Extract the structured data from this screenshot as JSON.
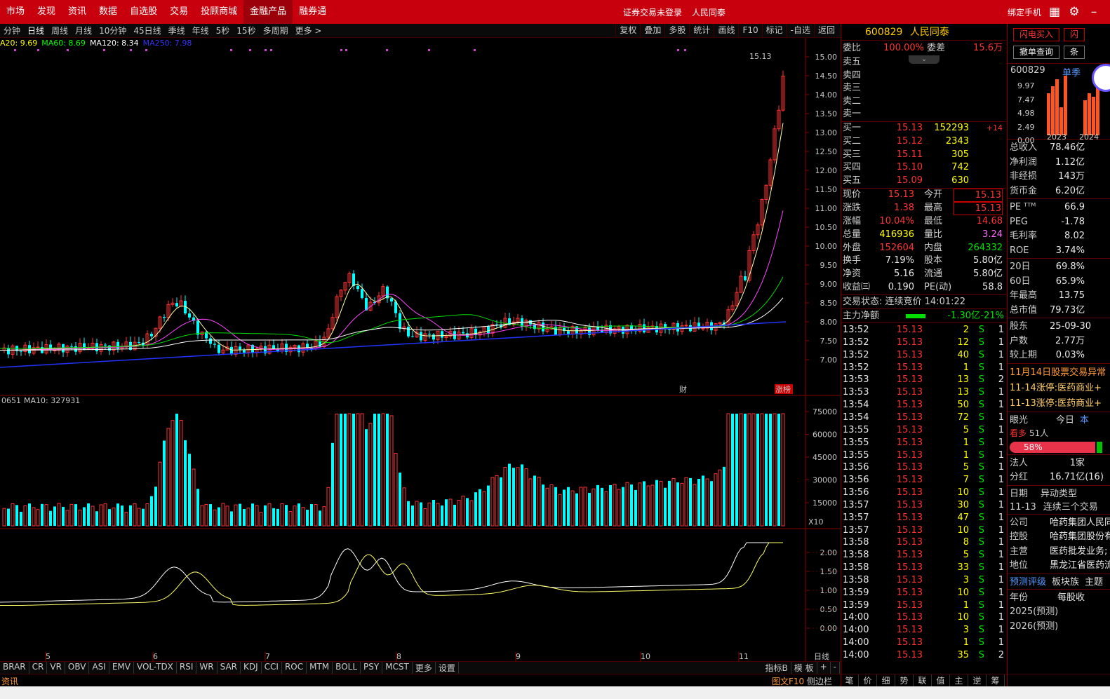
{
  "topbar": {
    "nav": [
      "市场",
      "发现",
      "资讯",
      "数据",
      "自选股",
      "交易",
      "投顾商城",
      "金融产品",
      "融券通"
    ],
    "active": "金融产品",
    "login": "证券交易未登录",
    "bank": "人民同泰",
    "bind": "绑定手机"
  },
  "periods": [
    "分钟",
    "日线",
    "周线",
    "月线",
    "10分钟",
    "45日线",
    "季线",
    "年线",
    "5秒",
    "15秒",
    "多周期",
    "更多 >"
  ],
  "active_period": "日线",
  "tools": [
    "复权",
    "叠加",
    "多股",
    "统计",
    "画线",
    "F10",
    "标记",
    "-自选",
    "返回"
  ],
  "ma_legend": [
    {
      "label": "A20: 9.69",
      "color": "#ffff00"
    },
    {
      "label": "MA60: 8.69",
      "color": "#00ff00"
    },
    {
      "label": "MA120: 8.34",
      "color": "#ffffff"
    },
    {
      "label": "MA250: 7.98",
      "color": "#3333ff"
    }
  ],
  "price_axis": [
    "15.00",
    "14.50",
    "14.00",
    "13.50",
    "13.00",
    "12.50",
    "12.00",
    "11.50",
    "11.00",
    "10.50",
    "10.00",
    "9.50",
    "9.00",
    "8.50",
    "8.00",
    "7.50",
    "7.00"
  ],
  "high_label": "15.13",
  "chart_tags": {
    "cai": "财",
    "zhangting": "涨榜"
  },
  "vol_legend": {
    "vol": "0651",
    "ma10": "MA10: 327931"
  },
  "vol_axis": [
    "75000",
    "60000",
    "45000",
    "30000",
    "15000"
  ],
  "vol_unit": "X10",
  "macd_axis": [
    "2.00",
    "1.50",
    "1.00",
    "0.50",
    "0.00"
  ],
  "date_axis": [
    "5",
    "6",
    "7",
    "8",
    "9",
    "10",
    "11"
  ],
  "day_label": "日线",
  "indicators": [
    "BRAR",
    "CR",
    "VR",
    "OBV",
    "ASI",
    "EMV",
    "VOL-TDX",
    "RSI",
    "WR",
    "SAR",
    "KDJ",
    "CCI",
    "ROC",
    "MTM",
    "BOLL",
    "PSY",
    "MCST",
    "更多",
    "设置"
  ],
  "ind_right": [
    "指标B",
    "模 板",
    "+",
    "-"
  ],
  "status": {
    "left": "资讯",
    "doc": "图文F10",
    "side": "侧边栏"
  },
  "stock": {
    "code": "600829",
    "name": "人民同泰"
  },
  "weibi": {
    "l1": "委比",
    "v1": "100.00%",
    "l2": "委差",
    "v2": "15.6万"
  },
  "sells": [
    "卖五",
    "卖四",
    "卖三",
    "卖二",
    "卖一"
  ],
  "buys": [
    {
      "l": "买一",
      "p": "15.13",
      "v": "152293",
      "c": "+14"
    },
    {
      "l": "买二",
      "p": "15.12",
      "v": "2343",
      "c": ""
    },
    {
      "l": "买三",
      "p": "15.11",
      "v": "305",
      "c": ""
    },
    {
      "l": "买四",
      "p": "15.10",
      "v": "742",
      "c": ""
    },
    {
      "l": "买五",
      "p": "15.09",
      "v": "630",
      "c": ""
    }
  ],
  "quote": [
    {
      "l1": "现价",
      "v1": "15.13",
      "l2": "今开",
      "v2": "15.13",
      "c1": "red",
      "c2": "red"
    },
    {
      "l1": "涨跌",
      "v1": "1.38",
      "l2": "最高",
      "v2": "15.13",
      "c1": "red",
      "c2": "red"
    },
    {
      "l1": "涨幅",
      "v1": "10.04%",
      "l2": "最低",
      "v2": "14.68",
      "c1": "red",
      "c2": "red"
    },
    {
      "l1": "总量",
      "v1": "416936",
      "l2": "量比",
      "v2": "3.24",
      "c1": "yellow",
      "c2": "mag"
    },
    {
      "l1": "外盘",
      "v1": "152604",
      "l2": "内盘",
      "v2": "264332",
      "c1": "red",
      "c2": "green"
    },
    {
      "l1": "换手",
      "v1": "7.19%",
      "l2": "股本",
      "v2": "5.80亿",
      "c1": "white",
      "c2": "white"
    },
    {
      "l1": "净资",
      "v1": "5.16",
      "l2": "流通",
      "v2": "5.80亿",
      "c1": "white",
      "c2": "white"
    },
    {
      "l1": "收益㈢",
      "v1": "0.190",
      "l2": "PE(动)",
      "v2": "58.8",
      "c1": "white",
      "c2": "white"
    }
  ],
  "trade_state": "交易状态: 连续竞价 14:01:22",
  "main_flow": {
    "label": "主力净额",
    "value": "-1.30亿",
    "pct": "-21%"
  },
  "ticks": [
    [
      "13:52",
      "15.13",
      "2",
      "S",
      "1"
    ],
    [
      "13:52",
      "15.13",
      "12",
      "S",
      "1"
    ],
    [
      "13:52",
      "15.13",
      "40",
      "S",
      "1"
    ],
    [
      "13:52",
      "15.13",
      "1",
      "S",
      "1"
    ],
    [
      "13:53",
      "15.13",
      "13",
      "S",
      "2"
    ],
    [
      "13:53",
      "15.13",
      "13",
      "S",
      "1"
    ],
    [
      "13:54",
      "15.13",
      "50",
      "S",
      "1"
    ],
    [
      "13:54",
      "15.13",
      "72",
      "S",
      "1"
    ],
    [
      "13:55",
      "15.13",
      "5",
      "S",
      "1"
    ],
    [
      "13:55",
      "15.13",
      "1",
      "S",
      "1"
    ],
    [
      "13:55",
      "15.13",
      "1",
      "S",
      "1"
    ],
    [
      "13:56",
      "15.13",
      "5",
      "S",
      "1"
    ],
    [
      "13:56",
      "15.13",
      "7",
      "S",
      "1"
    ],
    [
      "13:56",
      "15.13",
      "10",
      "S",
      "1"
    ],
    [
      "13:57",
      "15.13",
      "30",
      "S",
      "1"
    ],
    [
      "13:57",
      "15.13",
      "47",
      "S",
      "1"
    ],
    [
      "13:57",
      "15.13",
      "10",
      "S",
      "1"
    ],
    [
      "13:58",
      "15.13",
      "8",
      "S",
      "1"
    ],
    [
      "13:58",
      "15.13",
      "5",
      "S",
      "1"
    ],
    [
      "13:58",
      "15.13",
      "33",
      "S",
      "1"
    ],
    [
      "13:58",
      "15.13",
      "3",
      "S",
      "1"
    ],
    [
      "13:59",
      "15.13",
      "10",
      "S",
      "1"
    ],
    [
      "13:59",
      "15.13",
      "1",
      "S",
      "1"
    ],
    [
      "14:00",
      "15.13",
      "10",
      "S",
      "1"
    ],
    [
      "14:00",
      "15.13",
      "3",
      "S",
      "1"
    ],
    [
      "14:00",
      "15.13",
      "1",
      "S",
      "1"
    ],
    [
      "14:00",
      "15.13",
      "35",
      "S",
      "2"
    ]
  ],
  "tick_tabs": [
    "笔",
    "价",
    "细",
    "势",
    "联",
    "值",
    "主",
    "逆",
    "筹"
  ],
  "fr": {
    "btn1": "闪电买入",
    "btn2": "撤单查询",
    "code": "600829",
    "season": "单季",
    "yaxis": [
      "9.97",
      "7.47",
      "4.98",
      "2.49",
      "0.00"
    ],
    "years": [
      "2023",
      "2024"
    ],
    "fin": [
      [
        "总收入",
        "78.46亿"
      ],
      [
        "净利润",
        "1.12亿"
      ],
      [
        "非经损",
        "143万"
      ],
      [
        "货币金",
        "6.20亿"
      ]
    ],
    "val": [
      [
        "PE ᵀᵀᴹ",
        "66.9"
      ],
      [
        "PEG",
        "-1.78"
      ],
      [
        "毛利率",
        "8.02"
      ],
      [
        "ROE",
        "3.74%"
      ]
    ],
    "perf": [
      [
        "20日",
        "69.8%"
      ],
      [
        "60日",
        "65.9%"
      ],
      [
        "年最高",
        "13.75"
      ],
      [
        "总市值",
        "79.73亿"
      ]
    ],
    "holders": [
      [
        "股东",
        "25-09-30"
      ],
      [
        "户数",
        "2.77万"
      ],
      [
        "较上期",
        "0.03%"
      ]
    ],
    "news": [
      "11月14日股票交易异常",
      "11-14涨停:医药商业+",
      "11-13涨停:医药商业+"
    ],
    "eye": {
      "l": "眼光",
      "today": "今日",
      "bull": "看多",
      "count": "51人",
      "pct": "58%"
    },
    "corp": [
      [
        "法人",
        "1家"
      ],
      [
        "分红",
        "16.71亿(16)"
      ]
    ],
    "abn": {
      "h1": "日期",
      "h2": "异动类型",
      "d": "11-13",
      "t": "连续三个交易"
    },
    "info": [
      [
        "公司",
        "哈药集团人民同"
      ],
      [
        "控股",
        "哈药集团股份有"
      ],
      [
        "主营",
        "医药批发业务;"
      ],
      [
        "地位",
        "黑龙江省医药流"
      ]
    ],
    "pred": [
      "预测评级",
      "板块族",
      "主题"
    ],
    "fy": [
      [
        "年份",
        "每股收"
      ],
      [
        "2025(预测)",
        ""
      ],
      [
        "2026(预测)",
        ""
      ]
    ]
  }
}
